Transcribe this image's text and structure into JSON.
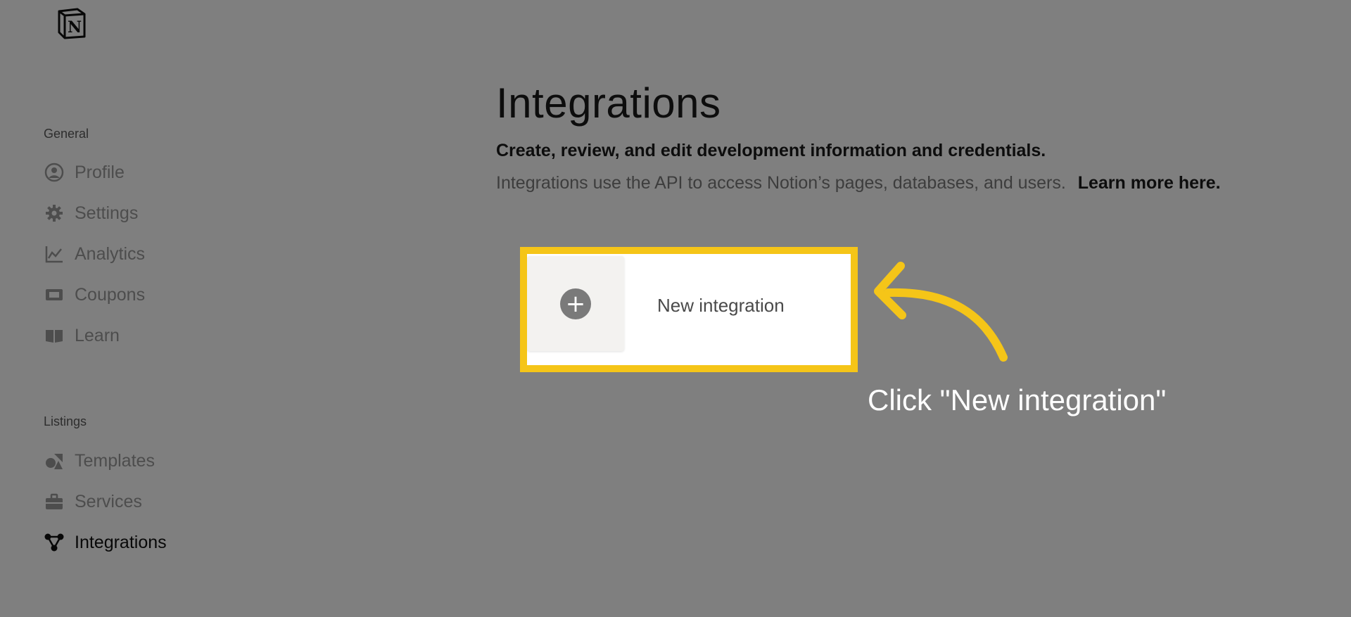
{
  "sidebar": {
    "logo_letter": "N",
    "sections": [
      {
        "label": "General",
        "items": [
          {
            "label": "Profile",
            "icon": "user-circle-icon"
          },
          {
            "label": "Settings",
            "icon": "gear-icon"
          },
          {
            "label": "Analytics",
            "icon": "chart-line-icon"
          },
          {
            "label": "Coupons",
            "icon": "ticket-icon"
          },
          {
            "label": "Learn",
            "icon": "book-icon"
          }
        ]
      },
      {
        "label": "Listings",
        "items": [
          {
            "label": "Templates",
            "icon": "shapes-icon"
          },
          {
            "label": "Services",
            "icon": "briefcase-icon"
          },
          {
            "label": "Integrations",
            "icon": "nodes-icon",
            "active": true
          }
        ]
      }
    ]
  },
  "main": {
    "title": "Integrations",
    "subtitle": "Create, review, and edit development information and credentials.",
    "description": "Integrations use the API to access Notion’s pages, databases, and users.",
    "learn_more": "Learn more here.",
    "new_integration": {
      "label": "New integration",
      "icon": "plus-circle-icon"
    }
  },
  "callout": {
    "text": "Click \"New integration\"",
    "highlight_color": "#f5c518"
  }
}
